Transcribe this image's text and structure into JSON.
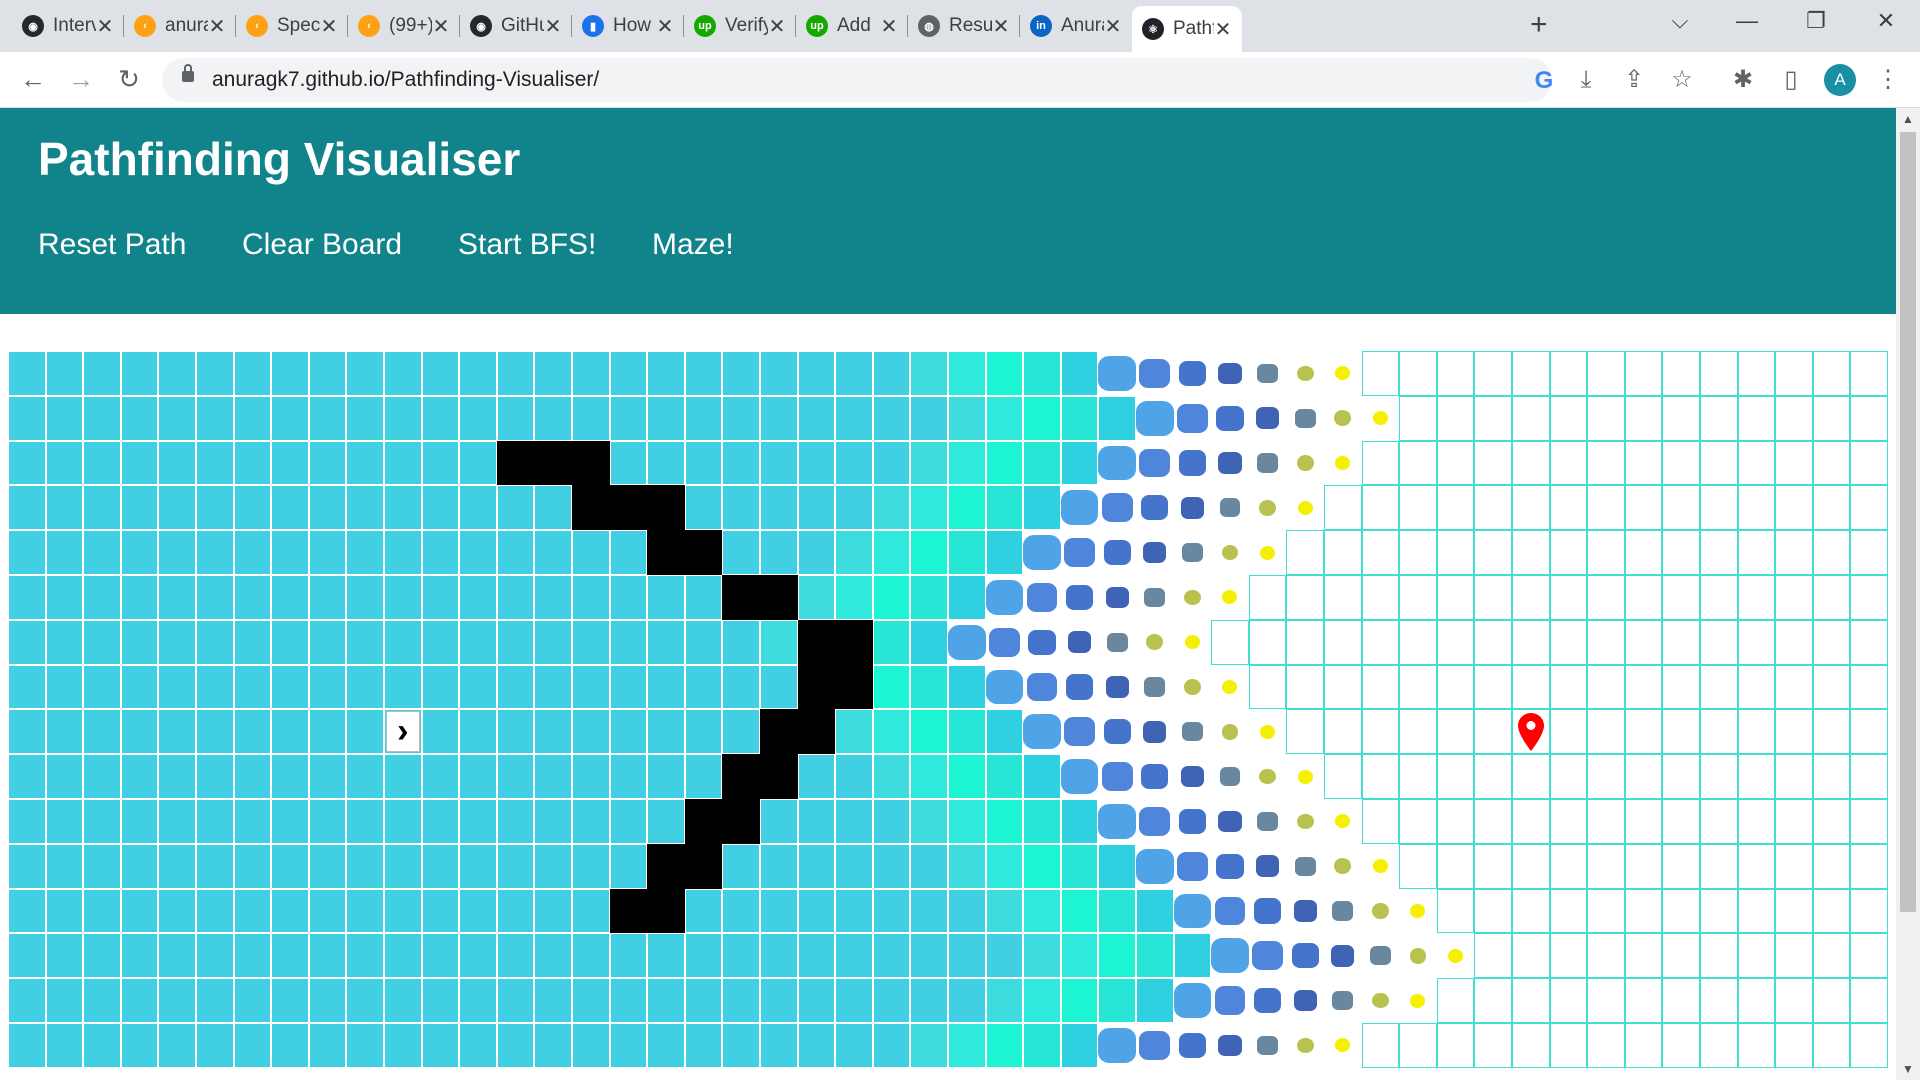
{
  "browser": {
    "tabs": [
      {
        "title": "Interview",
        "icon": "github-icon",
        "icon_color": "#24292f",
        "icon_glyph": "◉"
      },
      {
        "title": "anurag",
        "icon": "leetcode-icon",
        "icon_color": "#ffa116",
        "icon_glyph": "‹"
      },
      {
        "title": "Special",
        "icon": "leetcode-icon",
        "icon_color": "#ffa116",
        "icon_glyph": "‹"
      },
      {
        "title": "(99+)",
        "icon": "leetcode-icon",
        "icon_color": "#ffa116",
        "icon_glyph": "‹"
      },
      {
        "title": "GitHub",
        "icon": "github-icon",
        "icon_color": "#24292f",
        "icon_glyph": "◉"
      },
      {
        "title": "How",
        "icon": "bar-chart-icon",
        "icon_color": "#1a73e8",
        "icon_glyph": "▮"
      },
      {
        "title": "Verify",
        "icon": "upwork-icon",
        "icon_color": "#14a800",
        "icon_glyph": "up"
      },
      {
        "title": "Add",
        "icon": "upwork-icon",
        "icon_color": "#14a800",
        "icon_glyph": "up"
      },
      {
        "title": "Result",
        "icon": "globe-icon",
        "icon_color": "#5f6368",
        "icon_glyph": "◍"
      },
      {
        "title": "Anurag",
        "icon": "linkedin-icon",
        "icon_color": "#0a66c2",
        "icon_glyph": "in"
      },
      {
        "title": "Pathfinding",
        "icon": "react-icon",
        "icon_color": "#20232a",
        "icon_glyph": "⚛",
        "active": true
      }
    ],
    "new_tab_glyph": "+",
    "close_glyph": "✕",
    "window_controls": {
      "tab_search": "⌵",
      "minimize": "—",
      "restore": "❐",
      "close": "✕"
    },
    "nav": {
      "back": "←",
      "forward": "→",
      "reload": "↻"
    },
    "url": "anuragk7.github.io/Pathfinding-Visualiser/",
    "profile_initial": "A",
    "extensions": {
      "google": "G",
      "install": "⤓",
      "share": "⇪",
      "bookmark": "☆",
      "puzzle": "✱",
      "sidepanel": "▯",
      "menu": "⋮"
    }
  },
  "app": {
    "title": "Pathfinding Visualiser",
    "nav": [
      "Reset Path",
      "Clear Board",
      "Start BFS!",
      "Maze!"
    ]
  },
  "colors": {
    "header": "#10848a",
    "visited": "#40cfe3",
    "wall": "#000000",
    "unvisited_border": "#40e0d0",
    "target_marker": "#ff0000"
  },
  "grid": {
    "visible_rows": 16,
    "visible_cols": 50,
    "start": {
      "row": 8,
      "col": 10,
      "icon": "chevron-right-icon",
      "glyph": "›"
    },
    "target": {
      "row": 8,
      "col": 40,
      "icon": "map-pin-icon"
    },
    "walls": [
      [
        2,
        13
      ],
      [
        2,
        14
      ],
      [
        2,
        15
      ],
      [
        3,
        15
      ],
      [
        3,
        16
      ],
      [
        3,
        17
      ],
      [
        4,
        17
      ],
      [
        4,
        18
      ],
      [
        5,
        19
      ],
      [
        5,
        20
      ],
      [
        6,
        21
      ],
      [
        6,
        22
      ],
      [
        7,
        21
      ],
      [
        7,
        22
      ],
      [
        8,
        20
      ],
      [
        8,
        21
      ],
      [
        9,
        19
      ],
      [
        9,
        20
      ],
      [
        10,
        18
      ],
      [
        10,
        19
      ],
      [
        11,
        17
      ],
      [
        11,
        18
      ],
      [
        12,
        16
      ],
      [
        12,
        17
      ]
    ],
    "frontier_cols_by_row": [
      36,
      37,
      36,
      35,
      34,
      33,
      32,
      33,
      34,
      35,
      36,
      37,
      38,
      39,
      38,
      36
    ]
  }
}
